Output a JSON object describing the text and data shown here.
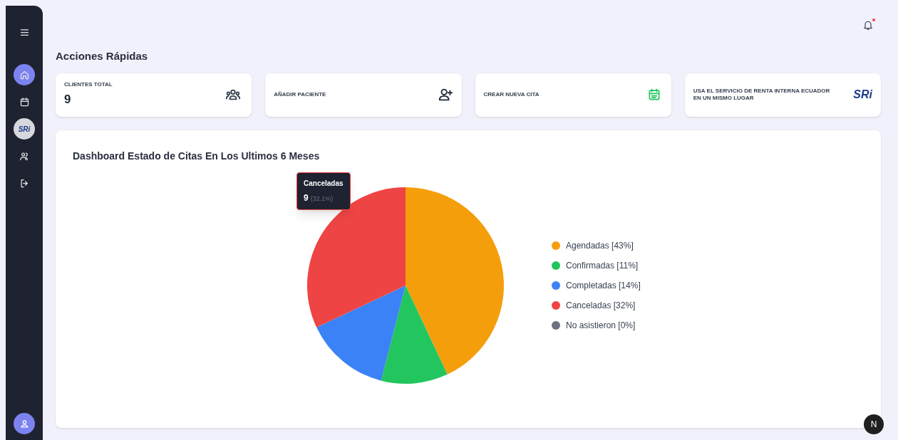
{
  "sidebar": {
    "items": [
      {
        "kind": "menu",
        "selected": false
      },
      {
        "kind": "home",
        "selected": true
      },
      {
        "kind": "calendar",
        "selected": false
      },
      {
        "kind": "logo",
        "label": "SRi",
        "selected": false
      },
      {
        "kind": "users",
        "selected": false
      },
      {
        "kind": "logout",
        "selected": false
      }
    ]
  },
  "header": {
    "notifications_unread": true
  },
  "section_title": "Acciones Rápidas",
  "cards": [
    {
      "kind": "stat",
      "label": "CLIENTES TOTAL",
      "value": "9"
    },
    {
      "kind": "action",
      "label": "AÑADIR PACIENTE"
    },
    {
      "kind": "action",
      "label": "CREAR NUEVA CITA"
    },
    {
      "kind": "action",
      "label": "USA EL SERVICIO DE RENTA INTERNA ECUADOR EN UN MISMO LUGAR",
      "logo_text": "SRi"
    }
  ],
  "chart_card": {
    "title": "Dashboard Estado de Citas En Los Ultimos 6 Meses",
    "chart_data": {
      "type": "pie",
      "categories": [
        "Agendadas [43%]",
        "Confirmadas [11%]",
        "Completadas [14%]",
        "Canceladas [32%]",
        "No asistieron [0%]"
      ],
      "values": [
        43,
        11,
        14,
        32,
        0
      ],
      "colors": [
        "#f59e0b",
        "#22c55e",
        "#3b82f6",
        "#ef4444",
        "#6b7280"
      ]
    },
    "tooltip": {
      "label": "Canceladas",
      "value": "9",
      "percent": "(32.1%)"
    }
  },
  "dev_badge": "N"
}
